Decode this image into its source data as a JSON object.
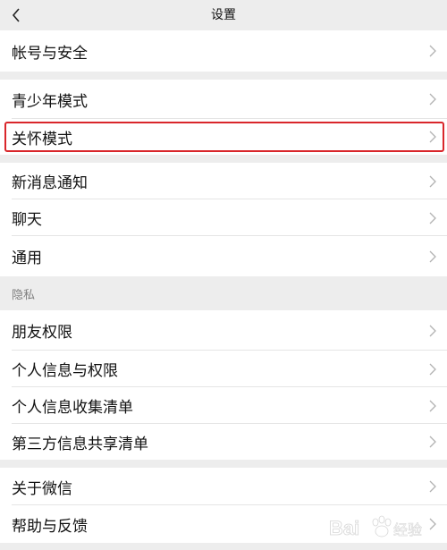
{
  "header": {
    "title": "设置",
    "back_icon": "chevron-left-icon"
  },
  "groups": [
    {
      "items": [
        {
          "label": "帐号与安全"
        }
      ]
    },
    {
      "items": [
        {
          "label": "青少年模式"
        },
        {
          "label": "关怀模式"
        }
      ]
    },
    {
      "items": [
        {
          "label": "新消息通知"
        },
        {
          "label": "聊天"
        },
        {
          "label": "通用"
        }
      ]
    },
    {
      "section_label": "隐私",
      "items": [
        {
          "label": "朋友权限"
        },
        {
          "label": "个人信息与权限"
        },
        {
          "label": "个人信息收集清单"
        },
        {
          "label": "第三方信息共享清单"
        }
      ]
    },
    {
      "items": [
        {
          "label": "关于微信"
        },
        {
          "label": "帮助与反馈"
        }
      ]
    }
  ],
  "highlight": {
    "target": "关怀模式",
    "color": "#d9262b"
  },
  "watermark": {
    "text": "Bai",
    "subtext": "经验",
    "icon": "baidu-paw-icon"
  }
}
